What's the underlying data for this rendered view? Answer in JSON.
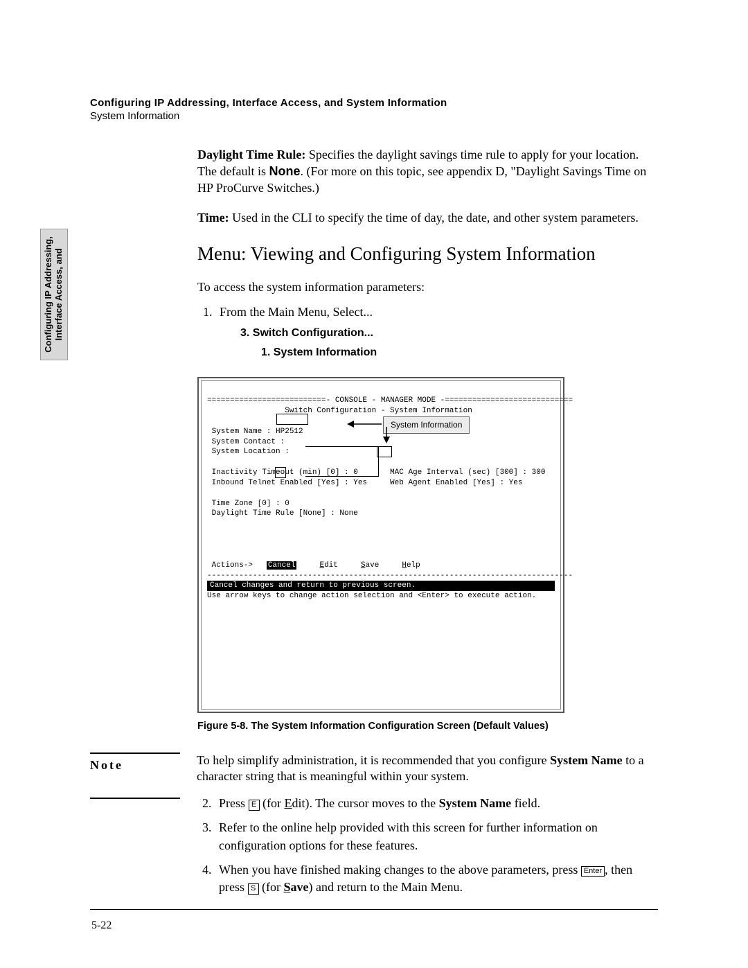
{
  "header": {
    "line1": "Configuring IP Addressing, Interface Access, and System Information",
    "line2": "System Information"
  },
  "side_tab": {
    "line1": "Configuring IP Addressing,",
    "line2": "Interface Access, and"
  },
  "para_daylight": {
    "label": "Daylight Time Rule:",
    "text": " Specifies the daylight savings time rule to apply for your location. The default is ",
    "bold_none": "None",
    "text2": ". (For more on this topic, see appendix D, \"Daylight Savings Time on HP ProCurve Switches.)"
  },
  "para_time": {
    "label": "Time:",
    "text": " Used in the CLI to specify the time of day, the date, and other system parameters."
  },
  "section_heading": "Menu: Viewing and Configuring System Information",
  "intro_line": "To access the system information parameters:",
  "step1_text": "From the Main Menu, Select...",
  "step1_sub1": "3. Switch Configuration...",
  "step1_sub2": "1. System Information",
  "console": {
    "title_line": "==========================- CONSOLE - MANAGER MODE -============================",
    "subtitle": "                 Switch Configuration - System Information",
    "blank": " ",
    "l_sysname": " System Name : HP2512",
    "l_contact": " System Contact :",
    "l_location": " System Location :",
    "l_inact": " Inactivity Timeout (min) [0] : 0       MAC Age Interval (sec) [300] : 300",
    "l_telnet": " Inbound Telnet Enabled [Yes] : Yes     Web Agent Enabled [Yes] : Yes",
    "l_tz": " Time Zone [0] : 0",
    "l_dst": " Daylight Time Rule [None] : None",
    "actions_prefix": " Actions->   ",
    "action_cancel": "Cancel",
    "action_edit_u": "E",
    "action_edit_r": "dit",
    "action_save_u": "S",
    "action_save_r": "ave",
    "action_help_u": "H",
    "action_help_r": "elp",
    "hr": "--------------------------------------------------------------------------------",
    "status_line": "Cancel changes and return to previous screen.",
    "hint_line": "Use arrow keys to change action selection and <Enter> to execute action."
  },
  "callout_label": "System Information",
  "figure_caption": "Figure 5-8.  The System Information Configuration Screen (Default Values)",
  "note": {
    "label": "Note",
    "body1": "To help simplify administration, it is recommended that you configure ",
    "body_bold": "System Name",
    "body2": "  to a character string that is meaningful within your system."
  },
  "steps2": {
    "s2_a": "Press ",
    "s2_key": "E",
    "s2_b": " (for ",
    "s2_edit_u": "E",
    "s2_edit_r": "dit). The cursor moves to the ",
    "s2_bold": "System Name",
    "s2_c": " field.",
    "s3": "Refer to the online help provided with this screen for further information on configuration options for these features.",
    "s4_a": "When you have finished making changes to the above parameters, press ",
    "s4_key1": "Enter",
    "s4_b": ", then press ",
    "s4_key2": "S",
    "s4_c": " (for ",
    "s4_bold_u": "S",
    "s4_bold_r": "ave",
    "s4_d": ") and return to the Main Menu."
  },
  "page_number": "5-22"
}
